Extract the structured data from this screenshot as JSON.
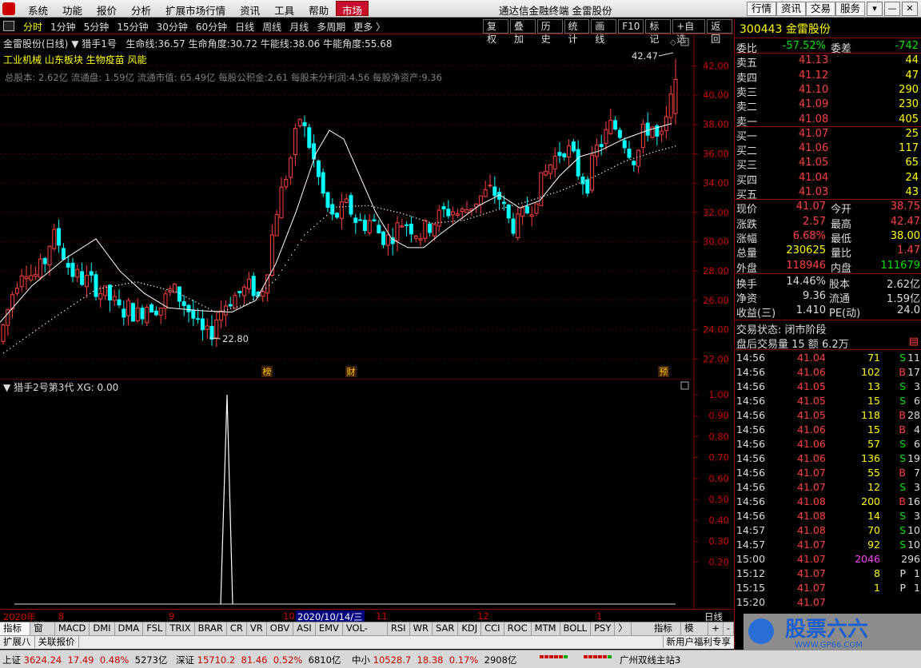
{
  "menu": {
    "items": [
      "系统",
      "功能",
      "报价",
      "分析",
      "扩展市场行情",
      "资讯",
      "工具",
      "帮助"
    ],
    "market": "市场",
    "title": "通达信金融终端  金雷股份",
    "right_buttons": [
      "行情",
      "资讯",
      "交易",
      "服务"
    ]
  },
  "tabs": {
    "periods": [
      "分时",
      "1分钟",
      "5分钟",
      "15分钟",
      "30分钟",
      "60分钟",
      "日线",
      "周线",
      "月线",
      "多周期",
      "更多 〉"
    ],
    "tools": [
      "复权",
      "叠加",
      "历史",
      "统计",
      "画线",
      "F10",
      "标记",
      "+自选",
      "返回"
    ]
  },
  "chart_header": {
    "name": "金雷股份(日线)",
    "formula": "猎手1号",
    "life_label": "生命线:",
    "life": "36.57",
    "life_angle_label": "生命角度:",
    "life_angle": "30.72",
    "bull_label": "牛能线:",
    "bull": "38.06",
    "bull_angle_label": "牛能角度:",
    "bull_angle": "55.68",
    "sectors": "工业机械 山东板块 生物疫苗 风能",
    "fund": "总股本: 2.62亿 流通盘: 1.59亿 流通市值: 65.49亿 每股公积金:2.61 每股未分利润:4.56 每股净资产:9.36"
  },
  "main_chart": {
    "price_axis": [
      "42.00",
      "40.00",
      "38.00",
      "36.00",
      "34.00",
      "32.00",
      "30.00",
      "28.00",
      "26.00",
      "24.00",
      "22.00"
    ],
    "high_label": "42.47",
    "low_label": "22.80",
    "markers": [
      "榜",
      "财",
      "预"
    ]
  },
  "sub_chart": {
    "title": "猎手2号第3代  XG: 0.00",
    "axis": [
      "1.00",
      "0.90",
      "0.80",
      "0.70",
      "0.60",
      "0.50",
      "0.40",
      "0.30",
      "0.20"
    ]
  },
  "time_axis": {
    "labels": [
      "2020年",
      "8",
      "9",
      "10",
      "2020/10/14/三",
      "11",
      "12",
      "1"
    ],
    "period": "日线"
  },
  "indicators": [
    "指标A",
    "窗口",
    "MACD",
    "DMI",
    "DMA",
    "FSL",
    "TRIX",
    "BRAR",
    "CR",
    "VR",
    "OBV",
    "ASI",
    "EMV",
    "VOL-TDX",
    "RSI",
    "WR",
    "SAR",
    "KDJ",
    "CCI",
    "ROC",
    "MTM",
    "BOLL",
    "PSY",
    "〉",
    "指标B",
    "模 板",
    "+",
    "-"
  ],
  "ext": {
    "left": [
      "扩展八",
      "关联报价"
    ],
    "right": "新用户福利专享"
  },
  "status": {
    "sh_label": "上证",
    "sh": "3624.24",
    "sh_chg": "17.49",
    "sh_pct": "0.48%",
    "sh_amt": "5273亿",
    "sz_label": "深证",
    "sz": "15710.2",
    "sz_chg": "81.46",
    "sz_pct": "0.52%",
    "sz_amt": "6810亿",
    "zx_label": "中小",
    "zx": "10528.7",
    "zx_chg": "18.38",
    "zx_pct": "0.17%",
    "zx_amt": "2908亿",
    "server": "广州双线主站3"
  },
  "quote": {
    "code": "300443",
    "name": "金雷股份",
    "ratio_label": "委比",
    "ratio": "-57.52%",
    "diff_label": "委差",
    "diff": "-742",
    "asks": [
      {
        "label": "卖五",
        "price": "41.13",
        "vol": "44"
      },
      {
        "label": "卖四",
        "price": "41.12",
        "vol": "47"
      },
      {
        "label": "卖三",
        "price": "41.10",
        "vol": "290"
      },
      {
        "label": "卖二",
        "price": "41.09",
        "vol": "230"
      },
      {
        "label": "卖一",
        "price": "41.08",
        "vol": "405"
      }
    ],
    "bids": [
      {
        "label": "买一",
        "price": "41.07",
        "vol": "25"
      },
      {
        "label": "买二",
        "price": "41.06",
        "vol": "117"
      },
      {
        "label": "买三",
        "price": "41.05",
        "vol": "65"
      },
      {
        "label": "买四",
        "price": "41.04",
        "vol": "24"
      },
      {
        "label": "买五",
        "price": "41.03",
        "vol": "43"
      }
    ],
    "stats": [
      {
        "l1": "现价",
        "v1": "41.07",
        "c1": "red",
        "l2": "今开",
        "v2": "38.75",
        "c2": "red"
      },
      {
        "l1": "涨跌",
        "v1": "2.57",
        "c1": "red",
        "l2": "最高",
        "v2": "42.47",
        "c2": "red"
      },
      {
        "l1": "涨幅",
        "v1": "6.68%",
        "c1": "red",
        "l2": "最低",
        "v2": "38.00",
        "c2": "yellow"
      },
      {
        "l1": "总量",
        "v1": "230625",
        "c1": "yellow",
        "l2": "量比",
        "v2": "1.47",
        "c2": "red"
      },
      {
        "l1": "外盘",
        "v1": "118946",
        "c1": "red",
        "l2": "内盘",
        "v2": "111679",
        "c2": "green"
      }
    ],
    "stats2": [
      {
        "l1": "换手",
        "v1": "14.46%",
        "l2": "股本",
        "v2": "2.62亿"
      },
      {
        "l1": "净资",
        "v1": "9.36",
        "l2": "流通",
        "v2": "1.59亿"
      },
      {
        "l1": "收益(三)",
        "v1": "1.410",
        "l2": "PE(动)",
        "v2": "24.0"
      }
    ],
    "trade_status": "交易状态: 闭市阶段",
    "after_hours": "盘后交易量 15 额 6.2万"
  },
  "ticks": [
    {
      "t": "14:56",
      "p": "41.04",
      "v": "71",
      "s": "S",
      "n": "11"
    },
    {
      "t": "14:56",
      "p": "41.06",
      "v": "102",
      "s": "B",
      "n": "17"
    },
    {
      "t": "14:56",
      "p": "41.05",
      "v": "13",
      "s": "S",
      "n": "3"
    },
    {
      "t": "14:56",
      "p": "41.05",
      "v": "15",
      "s": "S",
      "n": "6"
    },
    {
      "t": "14:56",
      "p": "41.05",
      "v": "118",
      "s": "B",
      "n": "28"
    },
    {
      "t": "14:56",
      "p": "41.06",
      "v": "15",
      "s": "B",
      "n": "4"
    },
    {
      "t": "14:56",
      "p": "41.06",
      "v": "57",
      "s": "S",
      "n": "6"
    },
    {
      "t": "14:56",
      "p": "41.06",
      "v": "136",
      "s": "S",
      "n": "19"
    },
    {
      "t": "14:56",
      "p": "41.07",
      "v": "55",
      "s": "B",
      "n": "7"
    },
    {
      "t": "14:56",
      "p": "41.07",
      "v": "12",
      "s": "S",
      "n": "3"
    },
    {
      "t": "14:56",
      "p": "41.08",
      "v": "200",
      "s": "B",
      "n": "16"
    },
    {
      "t": "14:56",
      "p": "41.08",
      "v": "14",
      "s": "S",
      "n": "3"
    },
    {
      "t": "14:57",
      "p": "41.08",
      "v": "70",
      "s": "S",
      "n": "10"
    },
    {
      "t": "14:57",
      "p": "41.07",
      "v": "92",
      "s": "S",
      "n": "10"
    },
    {
      "t": "15:00",
      "p": "41.07",
      "v": "2046",
      "s": "",
      "n": "296"
    },
    {
      "t": "15:12",
      "p": "41.07",
      "v": "8",
      "s": "P",
      "n": "1"
    },
    {
      "t": "15:15",
      "p": "41.07",
      "v": "1",
      "s": "P",
      "n": "1"
    },
    {
      "t": "15:20",
      "p": "41.07",
      "v": "",
      "s": "",
      "n": ""
    }
  ],
  "watermark": {
    "text": "股票六六",
    "url": "WWW.GP66.COM"
  },
  "colors": {
    "up": "#ff4040",
    "down": "#00ffff",
    "axis_red": "#800000",
    "ma": "#ffffff"
  }
}
